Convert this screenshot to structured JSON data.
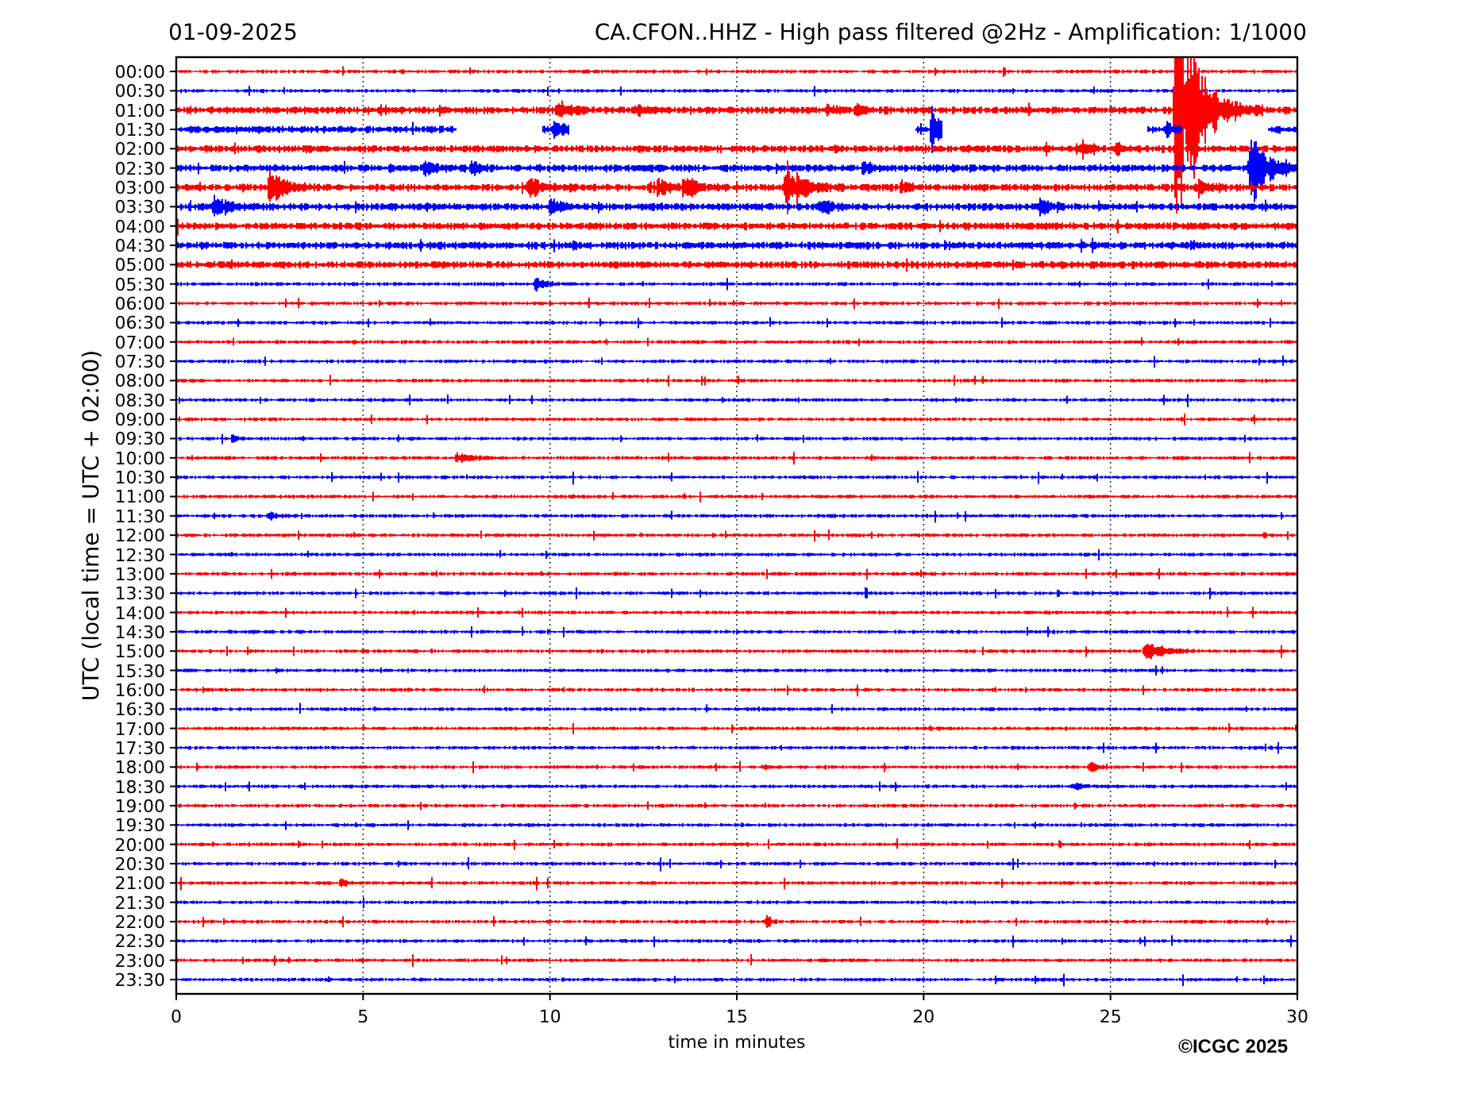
{
  "title_left": "01-09-2025",
  "title_right": "CA.CFON..HHZ - High pass filtered @2Hz - Amplification: 1/1000",
  "rows": [
    {
      "label": "00:00",
      "color": "#ff0000"
    },
    {
      "label": "00:30",
      "color": "#0000ff"
    },
    {
      "label": "01:00",
      "color": "#ff0000"
    },
    {
      "label": "01:30",
      "color": "#0000ff"
    },
    {
      "label": "02:00",
      "color": "#ff0000"
    },
    {
      "label": "02:30",
      "color": "#0000ff"
    },
    {
      "label": "03:00",
      "color": "#ff0000"
    },
    {
      "label": "03:30",
      "color": "#0000ff"
    },
    {
      "label": "04:00",
      "color": "#ff0000"
    },
    {
      "label": "04:30",
      "color": "#0000ff"
    },
    {
      "label": "05:00",
      "color": "#ff0000"
    },
    {
      "label": "05:30",
      "color": "#0000ff"
    },
    {
      "label": "06:00",
      "color": "#ff0000"
    },
    {
      "label": "06:30",
      "color": "#0000ff"
    },
    {
      "label": "07:00",
      "color": "#ff0000"
    },
    {
      "label": "07:30",
      "color": "#0000ff"
    },
    {
      "label": "08:00",
      "color": "#ff0000"
    },
    {
      "label": "08:30",
      "color": "#0000ff"
    },
    {
      "label": "09:00",
      "color": "#ff0000"
    },
    {
      "label": "09:30",
      "color": "#0000ff"
    },
    {
      "label": "10:00",
      "color": "#ff0000"
    },
    {
      "label": "10:30",
      "color": "#0000ff"
    },
    {
      "label": "11:00",
      "color": "#ff0000"
    },
    {
      "label": "11:30",
      "color": "#0000ff"
    },
    {
      "label": "12:00",
      "color": "#ff0000"
    },
    {
      "label": "12:30",
      "color": "#0000ff"
    },
    {
      "label": "13:00",
      "color": "#ff0000"
    },
    {
      "label": "13:30",
      "color": "#0000ff"
    },
    {
      "label": "14:00",
      "color": "#ff0000"
    },
    {
      "label": "14:30",
      "color": "#0000ff"
    },
    {
      "label": "15:00",
      "color": "#ff0000"
    },
    {
      "label": "15:30",
      "color": "#0000ff"
    },
    {
      "label": "16:00",
      "color": "#ff0000"
    },
    {
      "label": "16:30",
      "color": "#0000ff"
    },
    {
      "label": "17:00",
      "color": "#ff0000"
    },
    {
      "label": "17:30",
      "color": "#0000ff"
    },
    {
      "label": "18:00",
      "color": "#ff0000"
    },
    {
      "label": "18:30",
      "color": "#0000ff"
    },
    {
      "label": "19:00",
      "color": "#ff0000"
    },
    {
      "label": "19:30",
      "color": "#0000ff"
    },
    {
      "label": "20:00",
      "color": "#ff0000"
    },
    {
      "label": "20:30",
      "color": "#0000ff"
    },
    {
      "label": "21:00",
      "color": "#ff0000"
    },
    {
      "label": "21:30",
      "color": "#0000ff"
    },
    {
      "label": "22:00",
      "color": "#ff0000"
    },
    {
      "label": "22:30",
      "color": "#0000ff"
    },
    {
      "label": "23:00",
      "color": "#ff0000"
    },
    {
      "label": "23:30",
      "color": "#0000ff"
    }
  ],
  "x_ticks": [
    "0",
    "5",
    "10",
    "15",
    "20",
    "25",
    "30"
  ],
  "x_label": "time in minutes",
  "y_label": "UTC (local time = UTC + 02:00)",
  "copyright": "©ICGC 2025"
}
